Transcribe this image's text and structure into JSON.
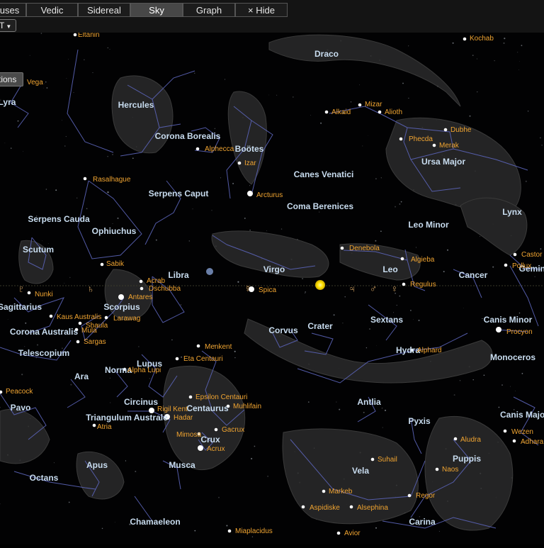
{
  "tabs": [
    {
      "label": "uses",
      "active": false
    },
    {
      "label": "Vedic",
      "active": false
    },
    {
      "label": "Sidereal",
      "active": false
    },
    {
      "label": "Sky",
      "active": true
    },
    {
      "label": "Graph",
      "active": false
    },
    {
      "label": "× Hide",
      "active": false
    }
  ],
  "timezone_select": {
    "value": "T"
  },
  "options_button": {
    "label": "tions"
  },
  "colors": {
    "constellation_label": "#c8dcef",
    "star_label": "#f0a431",
    "constellation_line": "#5b64b8",
    "sun": "#ffe000",
    "ecliptic": "#3a3a2a"
  },
  "constellations": [
    "Draco",
    "Lyra",
    "Hercules",
    "Corona Borealis",
    "Boötes",
    "Canes Venatici",
    "Ursa Major",
    "Serpens Caput",
    "Coma Berenices",
    "Lynx",
    "Serpens Cauda",
    "Ophiuchus",
    "Leo Minor",
    "Scutum",
    "Virgo",
    "Leo",
    "Cancer",
    "Libra",
    "Gemini",
    "Sagittarius",
    "Scorpius",
    "Corvus",
    "Crater",
    "Sextans",
    "Canis Minor",
    "Corona Australis",
    "Hydra",
    "Telescopium",
    "Lupus",
    "Norma",
    "Monoceros",
    "Ara",
    "Pavo",
    "Circinus",
    "Centaurus",
    "Antlia",
    "Triangulum Australe",
    "Pyxis",
    "Canis Major",
    "Crux",
    "Puppis",
    "Apus",
    "Musca",
    "Vela",
    "Octans",
    "Chamaeleon",
    "Carina"
  ],
  "stars": [
    "Eltanin",
    "Kochab",
    "Vega",
    "Mizar",
    "Alkaid",
    "Alioth",
    "Dubhe",
    "Phecda",
    "Merak",
    "Alphecca",
    "Izar",
    "Rasalhague",
    "Arcturus",
    "Denebola",
    "Castor",
    "Algieba",
    "Pollux",
    "Sabik",
    "Acrab",
    "Dschubba",
    "Spica",
    "Regulus",
    "Nunki",
    "Antares",
    "Kaus Australis",
    "Shaula",
    "Larawag",
    "Mula",
    "Sargas",
    "Procyon",
    "Menkent",
    "Alphard",
    "Eta Centauri",
    "Alpha Lupi",
    "Peacock",
    "Epsilon Centauri",
    "Rigil Kent",
    "Muhlifain",
    "Hadar",
    "Atria",
    "Gacrux",
    "Mimosa",
    "Acrux",
    "Wezen",
    "Aludra",
    "Adhara",
    "Suhail",
    "Naos",
    "Markeb",
    "Regor",
    "Aspidiske",
    "Alsephina",
    "Miaplacidus",
    "Avior"
  ],
  "planet_glyphs": [
    "♇",
    "♄",
    "♃",
    "♂",
    "♀",
    "☿"
  ]
}
